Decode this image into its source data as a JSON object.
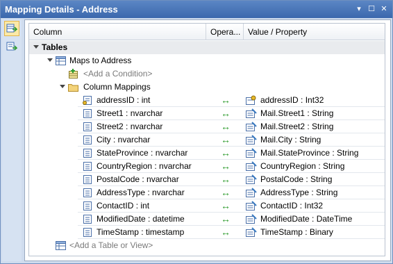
{
  "window": {
    "title": "Mapping Details - Address"
  },
  "titlebar_buttons": [
    "▾",
    "☐",
    "✕"
  ],
  "columns": {
    "col1": "Column",
    "col2": "Opera...",
    "col3": "Value / Property"
  },
  "tree": {
    "tables_label": "Tables",
    "maps_to": "Maps to Address",
    "add_condition": "<Add a Condition>",
    "column_mappings": "Column Mappings",
    "add_table": "<Add a Table or View>"
  },
  "mappings": [
    {
      "column": "addressID : int",
      "operator": "↔",
      "property": "addressID : Int32",
      "key": true
    },
    {
      "column": "Street1 : nvarchar",
      "operator": "↔",
      "property": "Mail.Street1 : String",
      "key": false
    },
    {
      "column": "Street2 : nvarchar",
      "operator": "↔",
      "property": "Mail.Street2 : String",
      "key": false
    },
    {
      "column": "City : nvarchar",
      "operator": "↔",
      "property": "Mail.City : String",
      "key": false
    },
    {
      "column": "StateProvince : nvarchar",
      "operator": "↔",
      "property": "Mail.StateProvince : String",
      "key": false
    },
    {
      "column": "CountryRegion : nvarchar",
      "operator": "↔",
      "property": "CountryRegion : String",
      "key": false
    },
    {
      "column": "PostalCode : nvarchar",
      "operator": "↔",
      "property": "PostalCode : String",
      "key": false
    },
    {
      "column": "AddressType : nvarchar",
      "operator": "↔",
      "property": "AddressType : String",
      "key": false
    },
    {
      "column": "ContactID : int",
      "operator": "↔",
      "property": "ContactID : Int32",
      "key": false
    },
    {
      "column": "ModifiedDate : datetime",
      "operator": "↔",
      "property": "ModifiedDate : DateTime",
      "key": false
    },
    {
      "column": "TimeStamp : timestamp",
      "operator": "↔",
      "property": "TimeStamp : Binary",
      "key": false
    }
  ],
  "colors": {
    "titlebar": "#3b68ad",
    "operator": "#2a9a2a",
    "muted": "#7a7a7a"
  }
}
